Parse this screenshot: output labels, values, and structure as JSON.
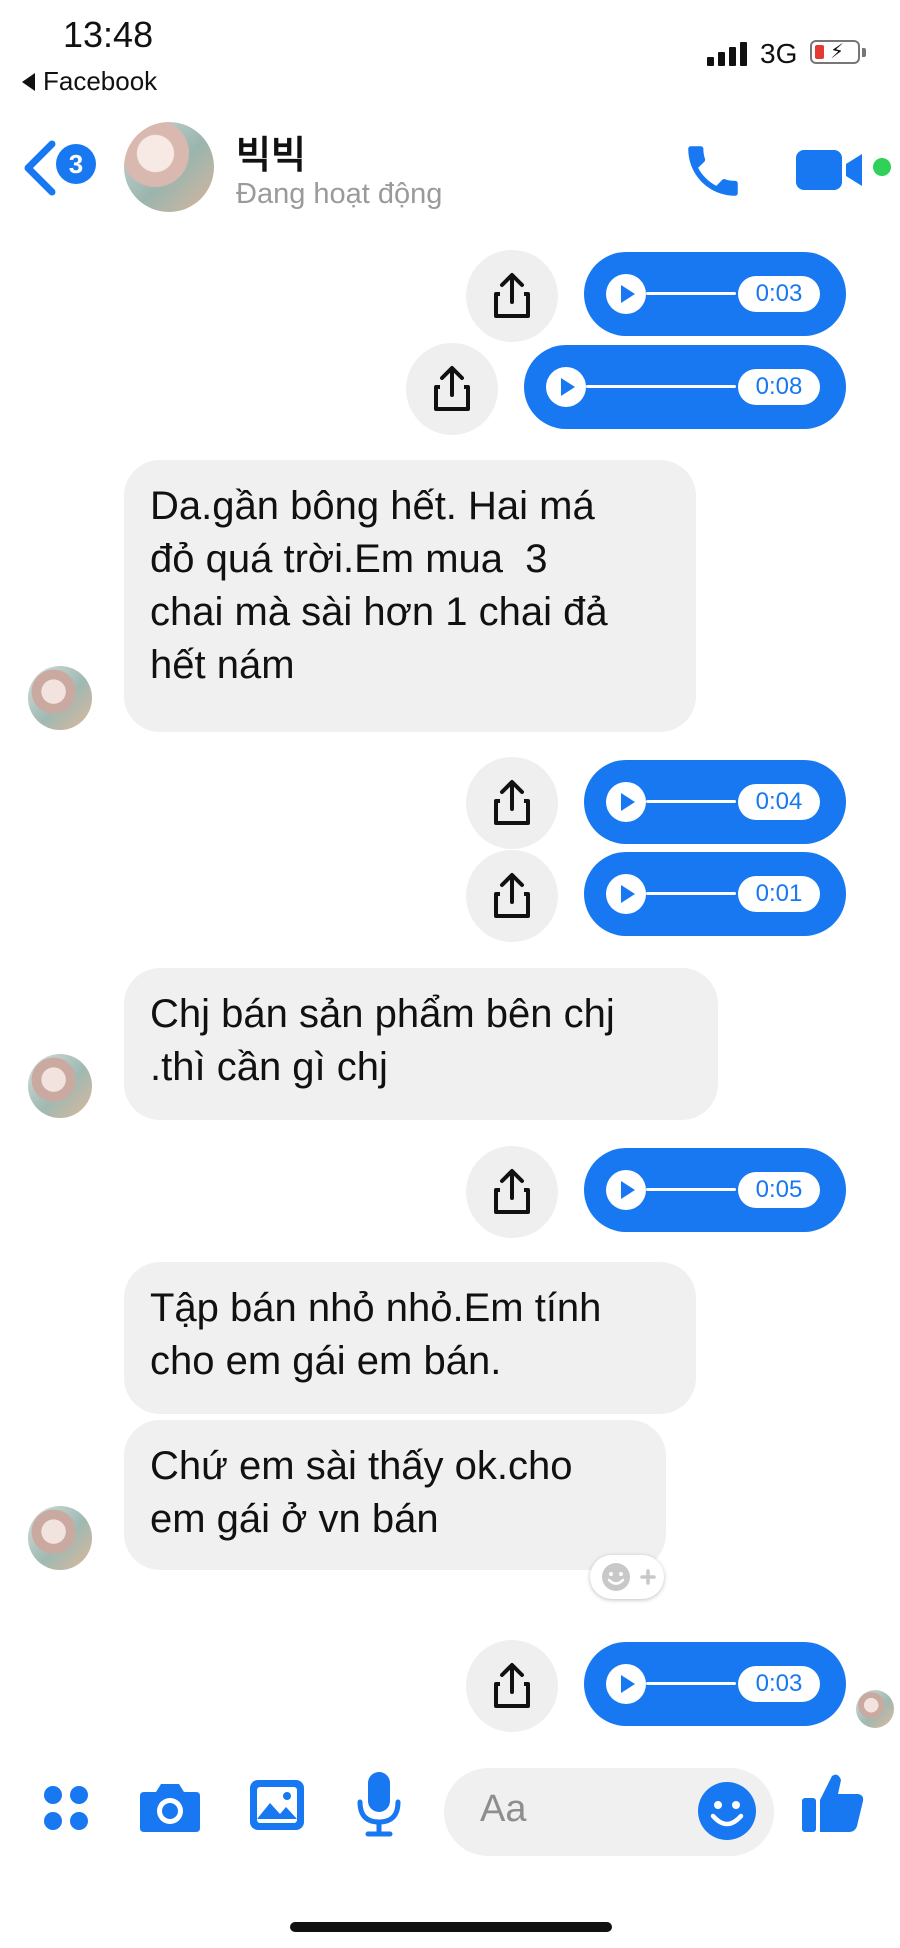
{
  "status_bar": {
    "time": "13:48",
    "back_app": "Facebook",
    "network": "3G"
  },
  "header": {
    "unread_count": "3",
    "contact_name": "빅빅",
    "contact_status": "Đang hoạt động",
    "icons": [
      "back-chevron-icon",
      "phone-icon",
      "video-camera-icon"
    ]
  },
  "messages": [
    {
      "type": "audio",
      "sender": "me",
      "duration": "0:03"
    },
    {
      "type": "audio",
      "sender": "me",
      "duration": "0:08"
    },
    {
      "type": "text",
      "sender": "contact",
      "text": "Da.gần bông hết. Hai má\nđỏ quá trời.Em mua  3\nchai mà sài hơn 1 chai đả\nhết nám"
    },
    {
      "type": "audio",
      "sender": "me",
      "duration": "0:04"
    },
    {
      "type": "audio",
      "sender": "me",
      "duration": "0:01"
    },
    {
      "type": "text",
      "sender": "contact",
      "text": "Chj bán sản phẩm bên chj\n.thì cần gì chj"
    },
    {
      "type": "audio",
      "sender": "me",
      "duration": "0:05"
    },
    {
      "type": "text",
      "sender": "contact",
      "text": "Tập bán nhỏ nhỏ.Em tính\ncho em gái em bán."
    },
    {
      "type": "text",
      "sender": "contact",
      "text": "Chứ em sài thấy ok.cho\nem gái ở vn bán"
    },
    {
      "type": "audio",
      "sender": "me",
      "duration": "0:03"
    }
  ],
  "composer": {
    "placeholder": "Aa",
    "icons": [
      "apps-grid-icon",
      "camera-icon",
      "photo-gallery-icon",
      "microphone-icon",
      "emoji-icon",
      "thumbs-up-icon"
    ]
  },
  "colors": {
    "accent": "#1778f2",
    "bubble_incoming": "#f0f0f0",
    "online": "#30d158"
  }
}
